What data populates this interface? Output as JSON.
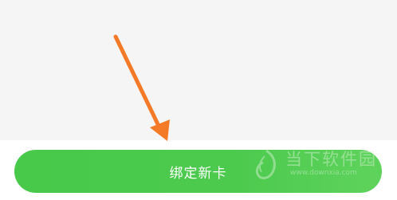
{
  "button": {
    "label": "绑定新卡"
  },
  "annotation": {
    "type": "arrow",
    "color": "#f47a28"
  },
  "watermark": {
    "brand": "当下软件园",
    "url": "www.downxia.com"
  },
  "colors": {
    "button_green": "#4cca4e",
    "background": "#f5f5f5"
  }
}
